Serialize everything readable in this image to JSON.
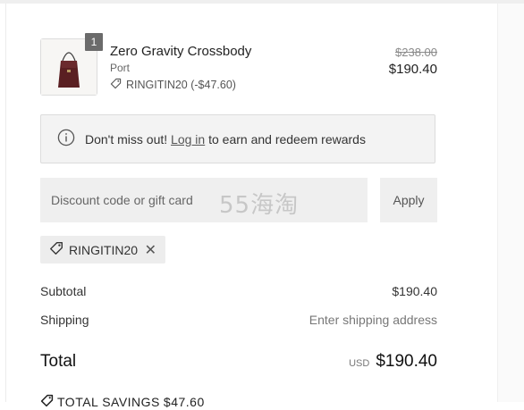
{
  "line_item": {
    "quantity": "1",
    "name": "Zero Gravity Crossbody",
    "variant": "Port",
    "discount": "RINGITIN20 (-$47.60)",
    "compare_price": "$238.00",
    "price": "$190.40",
    "icons": {
      "discount": "tag-icon"
    }
  },
  "notice": {
    "prefix": "Don't miss out! ",
    "link": "Log in",
    "suffix": " to earn and redeem rewards",
    "icon": "info-icon"
  },
  "discount_form": {
    "placeholder": "Discount code or gift card",
    "apply_label": "Apply"
  },
  "watermark": "55海淘",
  "applied_code": {
    "code": "RINGITIN20",
    "remove_symbol": "✕",
    "icon": "tag-icon"
  },
  "summary": {
    "subtotal_label": "Subtotal",
    "subtotal_value": "$190.40",
    "shipping_label": "Shipping",
    "shipping_value": "Enter shipping address",
    "total_label": "Total",
    "currency": "USD",
    "total_value": "$190.40"
  },
  "savings": {
    "label": "TOTAL SAVINGS",
    "value": "$47.60",
    "icon": "tag-icon"
  },
  "colors": {
    "panel_bg": "#f3f3f3",
    "field_bg": "#efefef",
    "badge": "#6b6b6b",
    "bag": "#5a1f22"
  }
}
